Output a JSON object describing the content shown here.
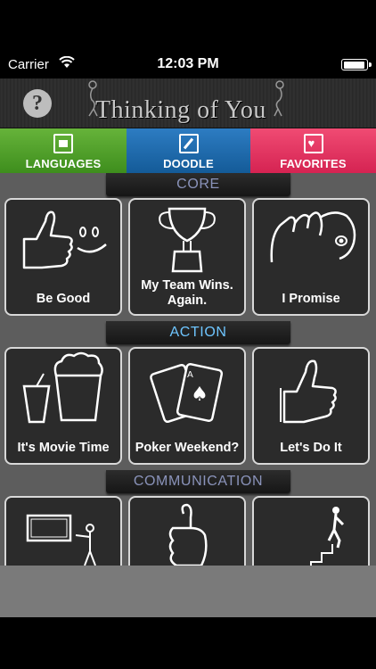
{
  "status_bar": {
    "carrier": "Carrier",
    "time": "12:03 PM"
  },
  "header": {
    "title": "Thinking of You",
    "help_label": "?"
  },
  "tabs": [
    {
      "label": "LANGUAGES",
      "color": "#4fa029"
    },
    {
      "label": "DOODLE",
      "color": "#1f6db0"
    },
    {
      "label": "FAVORITES",
      "color": "#e23560"
    }
  ],
  "sections": [
    {
      "title": "CORE",
      "tiles": [
        {
          "label": "Be Good",
          "icon": "thumbs-up-smiley-icon"
        },
        {
          "label": "My Team Wins. Again.",
          "icon": "trophy-icon"
        },
        {
          "label": "I Promise",
          "icon": "pinky-promise-icon"
        }
      ]
    },
    {
      "title": "ACTION",
      "tiles": [
        {
          "label": "It's Movie Time",
          "icon": "popcorn-drink-icon"
        },
        {
          "label": "Poker Weekend?",
          "icon": "playing-cards-icon"
        },
        {
          "label": "Let's Do It",
          "icon": "thumbs-up-icon"
        }
      ]
    },
    {
      "title": "COMMUNICATION",
      "tiles": [
        {
          "label": "",
          "icon": "presenter-board-icon"
        },
        {
          "label": "",
          "icon": "fist-thumb-icon"
        },
        {
          "label": "",
          "icon": "climbing-stairs-icon"
        }
      ]
    }
  ]
}
